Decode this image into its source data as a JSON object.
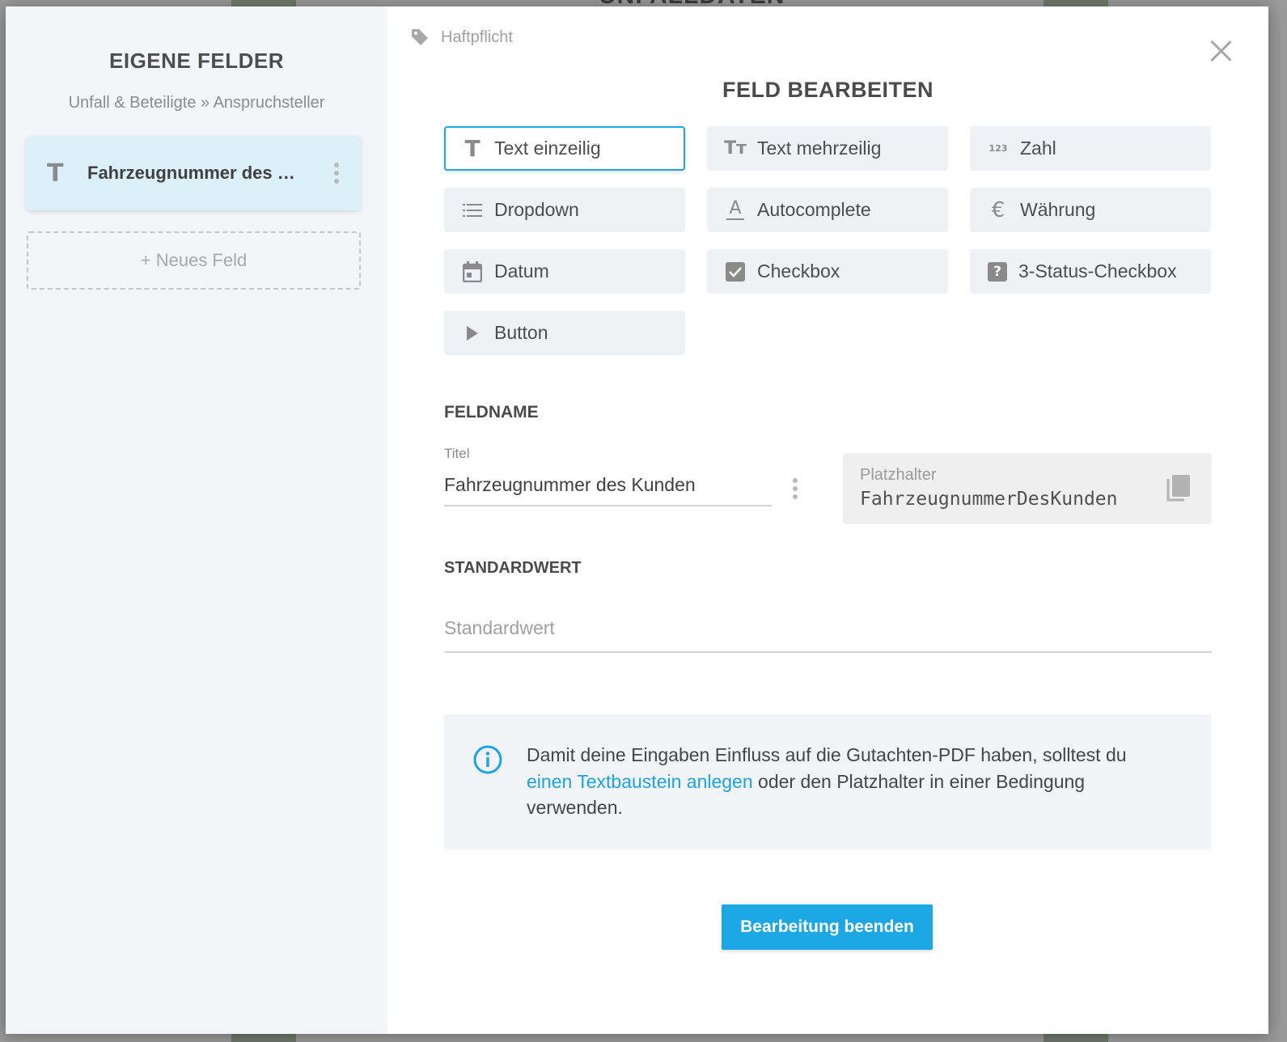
{
  "background": {
    "page_title": "UNFALLDATEN"
  },
  "sidebar": {
    "title": "EIGENE FELDER",
    "subtitle": "Unfall & Beteiligte » Anspruchsteller",
    "field_card": {
      "type_icon": "T",
      "label": "Fahrzeugnummer des Kunden"
    },
    "new_field_label": "+ Neues Feld"
  },
  "main": {
    "breadcrumb": "Haftpflicht",
    "title": "FELD BEARBEITEN",
    "types": [
      {
        "label": "Text einzeilig",
        "icon": "text-single-icon",
        "selected": true
      },
      {
        "label": "Text mehrzeilig",
        "icon": "text-multi-icon",
        "selected": false
      },
      {
        "label": "Zahl",
        "icon": "number-icon",
        "selected": false
      },
      {
        "label": "Dropdown",
        "icon": "list-icon",
        "selected": false
      },
      {
        "label": "Autocomplete",
        "icon": "autocomplete-icon",
        "selected": false
      },
      {
        "label": "Währung",
        "icon": "euro-icon",
        "selected": false
      },
      {
        "label": "Datum",
        "icon": "calendar-icon",
        "selected": false
      },
      {
        "label": "Checkbox",
        "icon": "checkbox-icon",
        "selected": false
      },
      {
        "label": "3-Status-Checkbox",
        "icon": "question-box-icon",
        "selected": false
      },
      {
        "label": "Button",
        "icon": "play-icon",
        "selected": false
      }
    ],
    "icon_glyphs": {
      "t": "T",
      "tt": "Tт",
      "num": "123",
      "euro": "€",
      "a": "A",
      "q": "?"
    },
    "fieldname": {
      "heading": "FELDNAME",
      "title_label": "Titel",
      "title_value": "Fahrzeugnummer des Kunden",
      "placeholder_label": "Platzhalter",
      "placeholder_value": "FahrzeugnummerDesKunden"
    },
    "default": {
      "heading": "STANDARDWERT",
      "placeholder": "Standardwert"
    },
    "info": {
      "text_before": "Damit deine Eingaben Einfluss auf die Gutachten-PDF haben, solltest du ",
      "link": "einen Textbaustein anlegen",
      "text_after": " oder den Platzhalter in einer Bedingung verwenden."
    },
    "finish_button": "Bearbeitung beenden"
  },
  "colors": {
    "accent": "#1ca6e4",
    "selected_card": "#dcf0fa",
    "sidebar_bg": "#f4f5f9"
  }
}
